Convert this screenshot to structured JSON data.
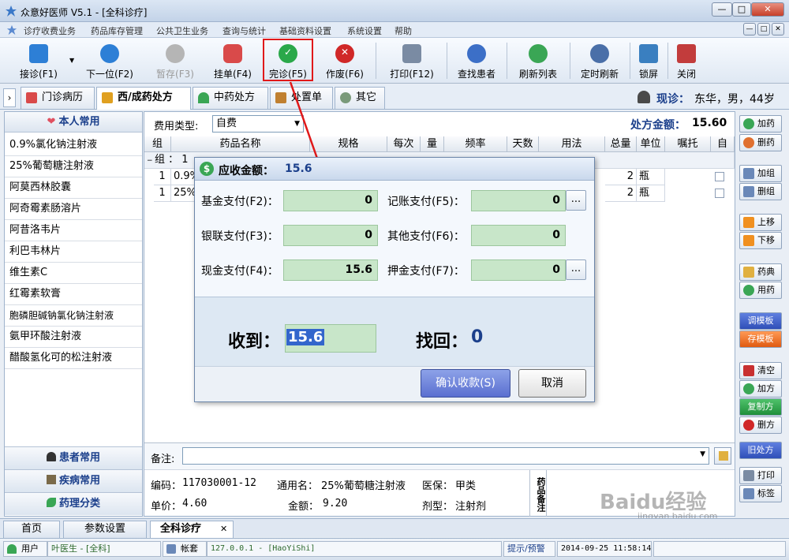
{
  "window": {
    "title": "众意好医师 V5.1 - [全科诊疗]",
    "controls": {
      "min": "—",
      "max": "□",
      "close": "✕"
    }
  },
  "menu": {
    "items": [
      "诊疗收费业务",
      "药品库存管理",
      "公共卫生业务",
      "查询与统计",
      "基础资料设置",
      "系统设置",
      "帮助"
    ]
  },
  "toolbar": {
    "items": [
      {
        "label": "接诊(F1)",
        "icon": "register-icon",
        "color": "#2d7fd6"
      },
      {
        "label": "下一位(F2)",
        "icon": "next-patient-icon",
        "color": "#2d7fd6"
      },
      {
        "label": "暂存(F3)",
        "icon": "hold-icon",
        "color": "#a0a0a0",
        "disabled": true
      },
      {
        "label": "挂单(F4)",
        "icon": "hang-order-icon",
        "color": "#d94a4a"
      },
      {
        "label": "完诊(F5)",
        "icon": "finish-check-icon",
        "color": "#2aa84a"
      },
      {
        "label": "作废(F6)",
        "icon": "void-x-icon",
        "color": "#d02828"
      },
      {
        "label": "打印(F12)",
        "icon": "printer-icon",
        "color": "#7a8ba3"
      },
      {
        "label": "查找患者",
        "icon": "search-icon",
        "color": "#3c6fc7"
      },
      {
        "label": "刷新列表",
        "icon": "refresh-icon",
        "color": "#3aa655"
      },
      {
        "label": "定时刷新",
        "icon": "eye-icon",
        "color": "#4a6fa8"
      },
      {
        "label": "锁屏",
        "icon": "lock-screen-icon",
        "color": "#3a7fc0"
      },
      {
        "label": "关闭",
        "icon": "exit-icon",
        "color": "#c23c3c"
      }
    ]
  },
  "tabs": {
    "items": [
      {
        "label": "门诊病历",
        "icon": "record-icon"
      },
      {
        "label": "西/成药处方",
        "icon": "pen-icon",
        "active": true
      },
      {
        "label": "中药处方",
        "icon": "herb-icon"
      },
      {
        "label": "处置单",
        "icon": "syringe-icon"
      },
      {
        "label": "其它",
        "icon": "misc-icon"
      }
    ],
    "patient_label": "现诊：",
    "patient_info": "东华，男，44岁"
  },
  "left_panel": {
    "header": "本人常用",
    "drugs": [
      "0.9%氯化钠注射液",
      "25%葡萄糖注射液",
      "阿莫西林胶囊",
      "阿奇霉素肠溶片",
      "阿昔洛韦片",
      "利巴韦林片",
      "维生素C",
      "红霉素软膏",
      "胞磷胆碱钠氯化钠注射液",
      "氨甲环酸注射液",
      "醋酸氢化可的松注射液"
    ],
    "footers": [
      "患者常用",
      "疾病常用",
      "药理分类"
    ]
  },
  "rx": {
    "fee_type_label": "费用类型:",
    "fee_type_value": "自费",
    "amount_label": "处方金额：",
    "amount_value": "15.60",
    "columns": [
      "组",
      "药品名称",
      "规格",
      "每次",
      "量",
      "频率",
      "天数",
      "用法",
      "总量",
      "单位",
      "嘱托",
      "自"
    ],
    "group_row": "组 ： 1",
    "rows": [
      {
        "group": "1",
        "name": "0.9%",
        "total": "2",
        "unit": "瓶"
      },
      {
        "group": "1",
        "name": "25%",
        "total": "2",
        "unit": "瓶"
      }
    ]
  },
  "remarks": {
    "label": "备注:"
  },
  "drug_info": {
    "code_label": "编码：",
    "code": "117030001-12",
    "generic_label": "通用名：",
    "generic": "25%葡萄糖注射液",
    "insurance_label": "医保：",
    "insurance": "甲类",
    "price_label": "单价：",
    "price": "4.60",
    "amount_label": "金额：",
    "amount": "9.20",
    "form_label": "剂型：",
    "form": "注射剂",
    "side_note": "药品备注"
  },
  "side_buttons": {
    "add_drug": "加药",
    "del_drug": "删药",
    "add_group": "加组",
    "del_group": "删组",
    "move_up": "上移",
    "move_down": "下移",
    "dictionary": "药典",
    "usage": "用药",
    "load_template": "调模板",
    "save_template": "存模板",
    "clear": "清空",
    "add_rx": "加方",
    "copy_rx": "复制方",
    "del_rx": "删方",
    "old_rx": "旧处方",
    "print": "打印",
    "label": "标签"
  },
  "dialog": {
    "title_label": "应收金额：",
    "title_value": "15.6",
    "fields": {
      "fund": {
        "label": "基金支付(F2)：",
        "value": "0"
      },
      "account": {
        "label": "记账支付(F5)：",
        "value": "0"
      },
      "unionpay": {
        "label": "银联支付(F3)：",
        "value": "0"
      },
      "other": {
        "label": "其他支付(F6)：",
        "value": "0"
      },
      "cash": {
        "label": "现金支付(F4)：",
        "value": "15.6"
      },
      "deposit": {
        "label": "押金支付(F7)：",
        "value": "0"
      }
    },
    "ellipsis": "...",
    "received_label": "收到：",
    "received_value": "15.6",
    "change_label": "找回：",
    "change_value": "0",
    "confirm": "确认收款(S)",
    "cancel": "取消"
  },
  "bottom_tabs": {
    "home": "首页",
    "settings": "参数设置",
    "active": "全科诊疗",
    "close": "✕"
  },
  "status": {
    "user_label": "用户",
    "user": "叶医生 - [全科]",
    "account_label": "帐套",
    "server": "127.0.0.1 - [HaoYiShi]",
    "alerts": "提示/预警",
    "datetime": "2014-09-25 11:58:14"
  },
  "watermark": {
    "text": "Baidu经验",
    "url": "jingyan.baidu.com"
  },
  "colors": {
    "accent_blue": "#1b3f8b",
    "dialog_value_blue": "#1b3f8b",
    "field_green": "#c8e6c9",
    "highlight_red": "#e0191a"
  }
}
